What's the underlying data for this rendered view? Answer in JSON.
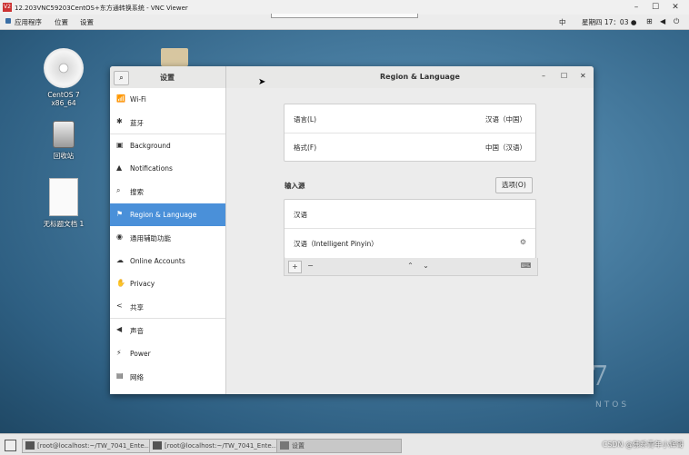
{
  "vnc": {
    "logo": "V2",
    "title": "12.203VNC59203CentOS+东方通转换系统 - VNC Viewer",
    "minimize": "–",
    "maximize": "☐",
    "close": "✕"
  },
  "top_bar": {
    "apps_menu": "应用程序",
    "places_menu": "位置",
    "settings_menu": "设置",
    "input_indicator": "中",
    "clock": "星期四 17：03 ●"
  },
  "desktop": {
    "icons": [
      {
        "label": "CentOS 7 x86_64"
      },
      {
        "label": "回收站"
      },
      {
        "label": "无标题文档 1"
      }
    ],
    "watermark_digit": "7",
    "watermark_text": "NTOS"
  },
  "settings_window": {
    "sidebar_title": "设置",
    "page_title": "Region & Language",
    "search_icon": "search-icon",
    "sidebar_items": [
      {
        "label": "Wi-Fi",
        "icon": "📶"
      },
      {
        "label": "蓝牙",
        "icon": "✱"
      },
      {
        "label": "Background",
        "icon": "▣"
      },
      {
        "label": "Notifications",
        "icon": "▲"
      },
      {
        "label": "搜索",
        "icon": "⌕"
      },
      {
        "label": "Region & Language",
        "icon": "⚑"
      },
      {
        "label": "通用辅助功能",
        "icon": "◉"
      },
      {
        "label": "Online Accounts",
        "icon": "☁"
      },
      {
        "label": "Privacy",
        "icon": "✋"
      },
      {
        "label": "共享",
        "icon": "<"
      },
      {
        "label": "声音",
        "icon": "◀"
      },
      {
        "label": "Power",
        "icon": "⚡"
      },
      {
        "label": "网络",
        "icon": "▤"
      }
    ],
    "language_row": {
      "label": "语言(L)",
      "value": "汉语（中国）"
    },
    "formats_row": {
      "label": "格式(F)",
      "value": "中国（汉语）"
    },
    "input_sources": {
      "heading": "输入源",
      "options_button": "选项(O)",
      "sources": [
        {
          "label": "汉语"
        },
        {
          "label": "汉语（Intelligent Pinyin）"
        }
      ],
      "add_label": "+",
      "remove_label": "−",
      "up_label": "⌃",
      "down_label": "⌄"
    }
  },
  "taskbar": {
    "tasks": [
      {
        "label": "[root@localhost:~/TW_7041_Ente..."
      },
      {
        "label": "[root@localhost:~/TW_7041_Ente..."
      },
      {
        "label": "设置"
      }
    ],
    "watermark": "CSDN @佛系青年小辉哥"
  }
}
